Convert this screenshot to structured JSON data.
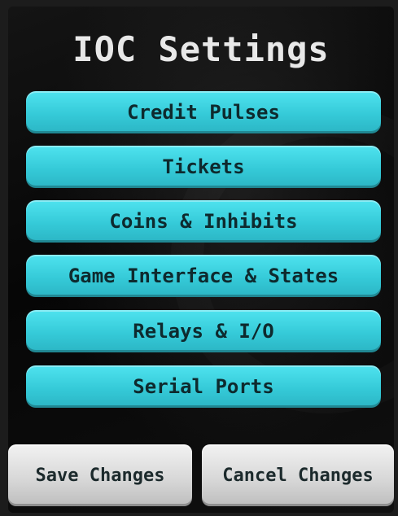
{
  "screen": {
    "title": "IOC Settings"
  },
  "menu": {
    "items": [
      {
        "label": "Credit Pulses"
      },
      {
        "label": "Tickets"
      },
      {
        "label": "Coins & Inhibits"
      },
      {
        "label": "Game Interface & States"
      },
      {
        "label": "Relays & I/O"
      },
      {
        "label": "Serial Ports"
      }
    ]
  },
  "actions": {
    "save_label": "Save Changes",
    "cancel_label": "Cancel Changes"
  },
  "colors": {
    "menu_button": "#35cad8",
    "action_button": "#d6d6d6",
    "background": "#0a0a0a",
    "title_text": "#e8e8e8"
  }
}
